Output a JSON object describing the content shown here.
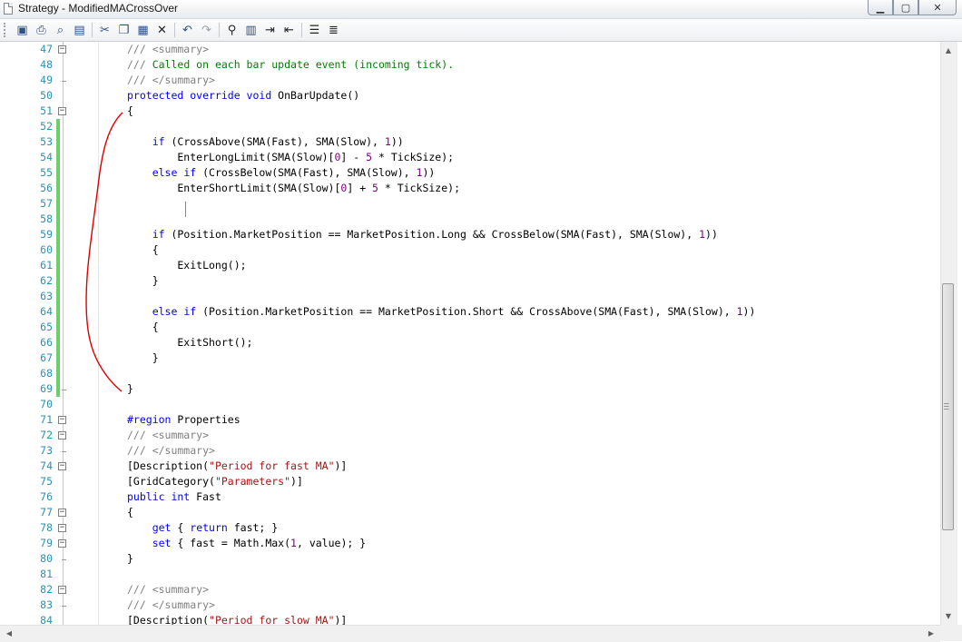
{
  "window": {
    "title": "Strategy - ModifiedMACrossOver",
    "buttons": {
      "minimize": "▁",
      "maximize": "▢",
      "close": "✕"
    }
  },
  "toolbar": {
    "icons": [
      "save-icon",
      "print-icon",
      "print-preview-icon",
      "open-icon",
      "cut-icon",
      "copy-icon",
      "paste-icon",
      "delete-icon",
      "undo-icon",
      "redo-icon",
      "find-icon",
      "replace-icon",
      "indent-icon",
      "outdent-icon",
      "comment-icon",
      "uncomment-icon"
    ]
  },
  "editor": {
    "lines": [
      {
        "n": "47",
        "code": [
          [
            "g",
            "/// <summary>"
          ]
        ]
      },
      {
        "n": "48",
        "code": [
          [
            "g",
            "/// "
          ],
          [
            "c",
            "Called on each bar update event (incoming tick)."
          ]
        ]
      },
      {
        "n": "49",
        "code": [
          [
            "g",
            "/// </summary>"
          ]
        ]
      },
      {
        "n": "50",
        "code": [
          [
            "k",
            "protected override void"
          ],
          [
            "t",
            " OnBarUpdate()"
          ]
        ]
      },
      {
        "n": "51",
        "code": [
          [
            "t",
            "{"
          ]
        ]
      },
      {
        "n": "52",
        "code": []
      },
      {
        "n": "53",
        "code": [
          [
            "t",
            "    "
          ],
          [
            "k",
            "if"
          ],
          [
            "t",
            " (CrossAbove(SMA(Fast), SMA(Slow), "
          ],
          [
            "n",
            "1"
          ],
          [
            "t",
            "))"
          ]
        ]
      },
      {
        "n": "54",
        "code": [
          [
            "t",
            "        EnterLongLimit(SMA(Slow)["
          ],
          [
            "n",
            "0"
          ],
          [
            "t",
            "] - "
          ],
          [
            "n",
            "5"
          ],
          [
            "t",
            " * TickSize);"
          ]
        ]
      },
      {
        "n": "55",
        "code": [
          [
            "t",
            "    "
          ],
          [
            "k",
            "else if"
          ],
          [
            "t",
            " (CrossBelow(SMA(Fast), SMA(Slow), "
          ],
          [
            "n",
            "1"
          ],
          [
            "t",
            "))"
          ]
        ]
      },
      {
        "n": "56",
        "code": [
          [
            "t",
            "        EnterShortLimit(SMA(Slow)["
          ],
          [
            "n",
            "0"
          ],
          [
            "t",
            "] + "
          ],
          [
            "n",
            "5"
          ],
          [
            "t",
            " * TickSize);"
          ]
        ]
      },
      {
        "n": "57",
        "code": []
      },
      {
        "n": "58",
        "code": []
      },
      {
        "n": "59",
        "code": [
          [
            "t",
            "    "
          ],
          [
            "k",
            "if"
          ],
          [
            "t",
            " (Position.MarketPosition == MarketPosition.Long && CrossBelow(SMA(Fast), SMA(Slow), "
          ],
          [
            "n",
            "1"
          ],
          [
            "t",
            "))"
          ]
        ]
      },
      {
        "n": "60",
        "code": [
          [
            "t",
            "    {"
          ]
        ]
      },
      {
        "n": "61",
        "code": [
          [
            "t",
            "        ExitLong();"
          ]
        ]
      },
      {
        "n": "62",
        "code": [
          [
            "t",
            "    }"
          ]
        ]
      },
      {
        "n": "63",
        "code": []
      },
      {
        "n": "64",
        "code": [
          [
            "t",
            "    "
          ],
          [
            "k",
            "else if"
          ],
          [
            "t",
            " (Position.MarketPosition == MarketPosition.Short && CrossAbove(SMA(Fast), SMA(Slow), "
          ],
          [
            "n",
            "1"
          ],
          [
            "t",
            "))"
          ]
        ]
      },
      {
        "n": "65",
        "code": [
          [
            "t",
            "    {"
          ]
        ]
      },
      {
        "n": "66",
        "code": [
          [
            "t",
            "        ExitShort();"
          ]
        ]
      },
      {
        "n": "67",
        "code": [
          [
            "t",
            "    }"
          ]
        ]
      },
      {
        "n": "68",
        "code": []
      },
      {
        "n": "69",
        "code": [
          [
            "t",
            "}"
          ]
        ]
      },
      {
        "n": "70",
        "code": []
      },
      {
        "n": "71",
        "code": [
          [
            "k",
            "#region"
          ],
          [
            "t",
            " Properties"
          ]
        ]
      },
      {
        "n": "72",
        "code": [
          [
            "g",
            "/// <summary>"
          ]
        ]
      },
      {
        "n": "73",
        "code": [
          [
            "g",
            "/// </summary>"
          ]
        ]
      },
      {
        "n": "74",
        "code": [
          [
            "t",
            "[Description("
          ],
          [
            "s",
            "\"Period for fast MA\""
          ],
          [
            "t",
            ")]"
          ]
        ]
      },
      {
        "n": "75",
        "code": [
          [
            "t",
            "[GridCategory("
          ],
          [
            "s",
            "\"Parameters\""
          ],
          [
            "t",
            ")]"
          ]
        ]
      },
      {
        "n": "76",
        "code": [
          [
            "k",
            "public int"
          ],
          [
            "t",
            " Fast"
          ]
        ]
      },
      {
        "n": "77",
        "code": [
          [
            "t",
            "{"
          ]
        ]
      },
      {
        "n": "78",
        "code": [
          [
            "t",
            "    "
          ],
          [
            "k",
            "get"
          ],
          [
            "t",
            " { "
          ],
          [
            "k",
            "return"
          ],
          [
            "t",
            " fast; }"
          ]
        ]
      },
      {
        "n": "79",
        "code": [
          [
            "t",
            "    "
          ],
          [
            "k",
            "set"
          ],
          [
            "t",
            " { fast = Math.Max("
          ],
          [
            "n",
            "1"
          ],
          [
            "t",
            ", value); }"
          ]
        ]
      },
      {
        "n": "80",
        "code": [
          [
            "t",
            "}"
          ]
        ]
      },
      {
        "n": "81",
        "code": []
      },
      {
        "n": "82",
        "code": [
          [
            "g",
            "/// <summary>"
          ]
        ]
      },
      {
        "n": "83",
        "code": [
          [
            "g",
            "/// </summary>"
          ]
        ]
      },
      {
        "n": "84",
        "code": [
          [
            "t",
            "[Description("
          ],
          [
            "s",
            "\"Period for slow MA\""
          ],
          [
            "t",
            ")]"
          ]
        ]
      }
    ]
  },
  "colors": {
    "keyword": "#0000ff",
    "comment": "#008000",
    "doc_tag": "#808080",
    "string": "#a31515",
    "number": "#800080",
    "line_number": "#2b91af",
    "annotation": "#e00000",
    "change_bar": "#6ccf6c"
  }
}
